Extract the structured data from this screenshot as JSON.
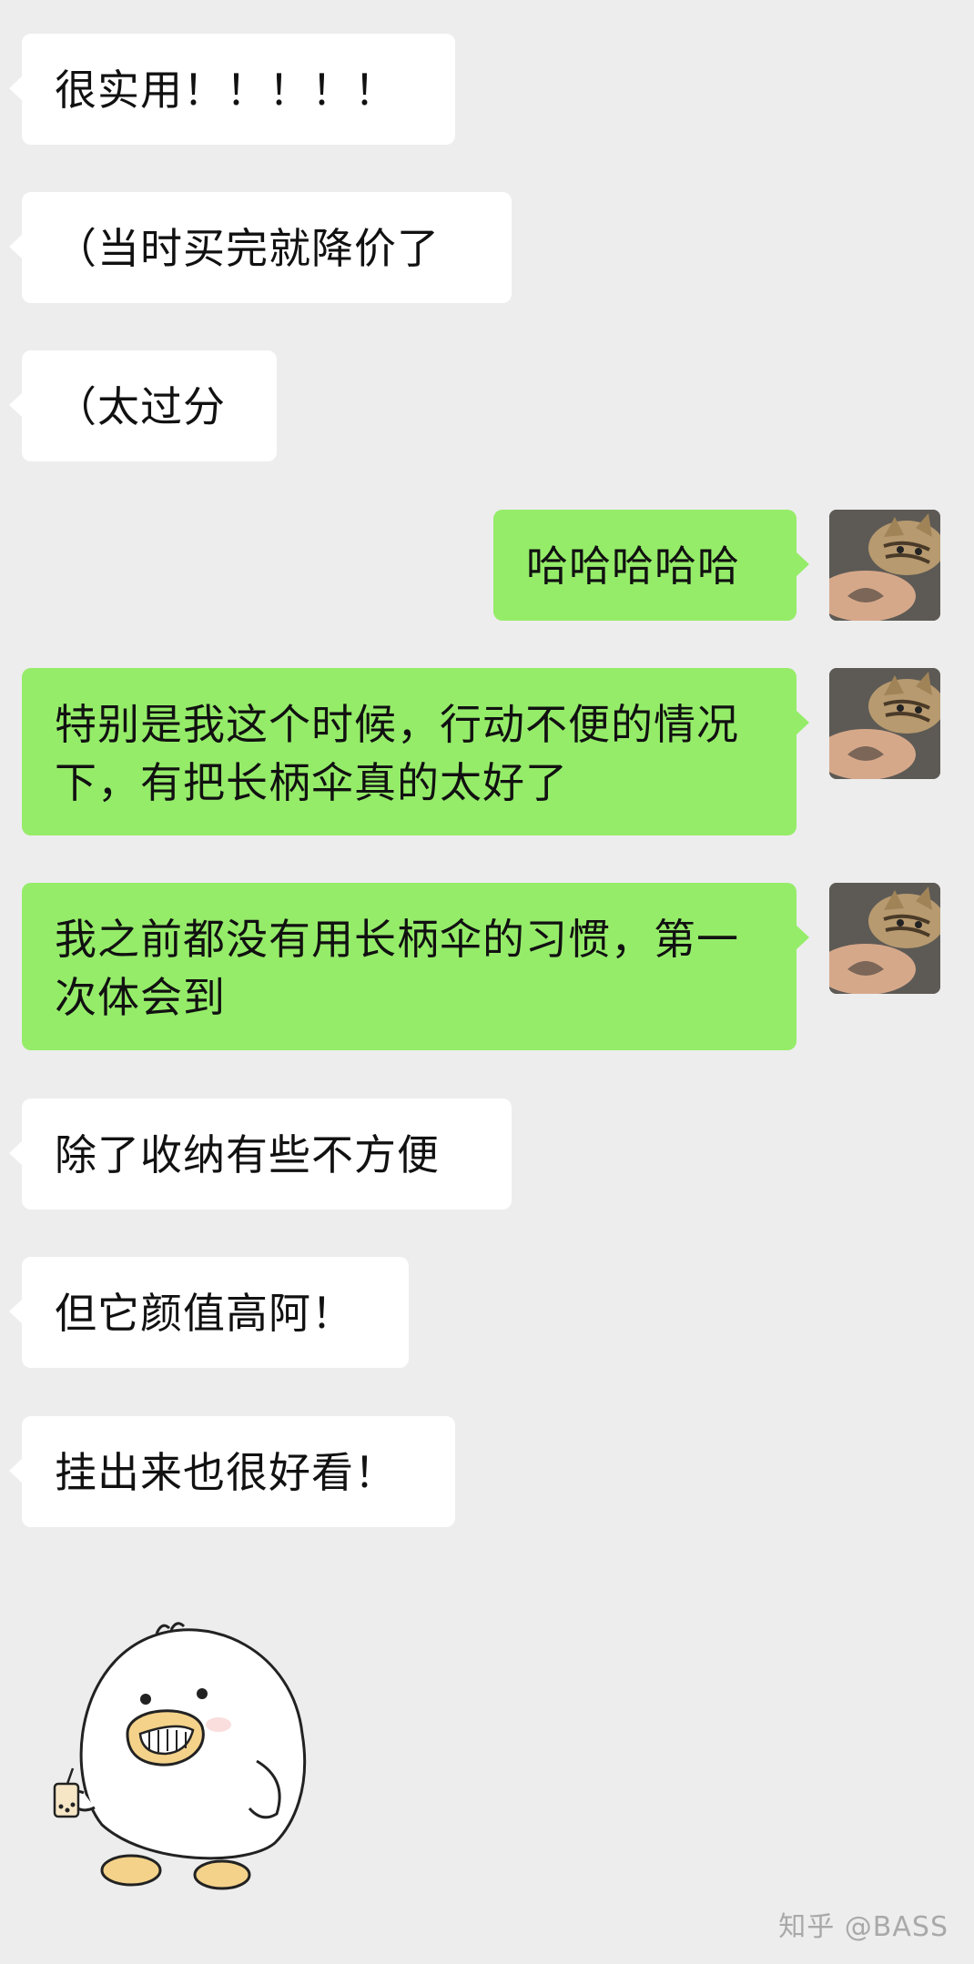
{
  "messages": [
    {
      "direction": "incoming",
      "text": "很实用！！！！！"
    },
    {
      "direction": "incoming",
      "text": "（当时买完就降价了"
    },
    {
      "direction": "incoming",
      "text": "（太过分"
    },
    {
      "direction": "outgoing",
      "text": "哈哈哈哈哈"
    },
    {
      "direction": "outgoing",
      "text": "特别是我这个时候，行动不便的情况下，有把长柄伞真的太好了"
    },
    {
      "direction": "outgoing",
      "text": "我之前都没有用长柄伞的习惯，第一次体会到"
    },
    {
      "direction": "incoming",
      "text": "除了收纳有些不方便"
    },
    {
      "direction": "incoming",
      "text": "但它颜值高阿！"
    },
    {
      "direction": "incoming",
      "text": "挂出来也很好看！"
    }
  ],
  "sticker": {
    "icon": "duck-with-bubble-tea-sticker"
  },
  "avatar": {
    "icon": "cat-avatar-icon"
  },
  "watermark": "知乎 @BASS",
  "colors": {
    "background": "#ededed",
    "incoming_bubble": "#ffffff",
    "outgoing_bubble": "#95ec69",
    "text": "#111111",
    "watermark": "#a9a9a9"
  }
}
